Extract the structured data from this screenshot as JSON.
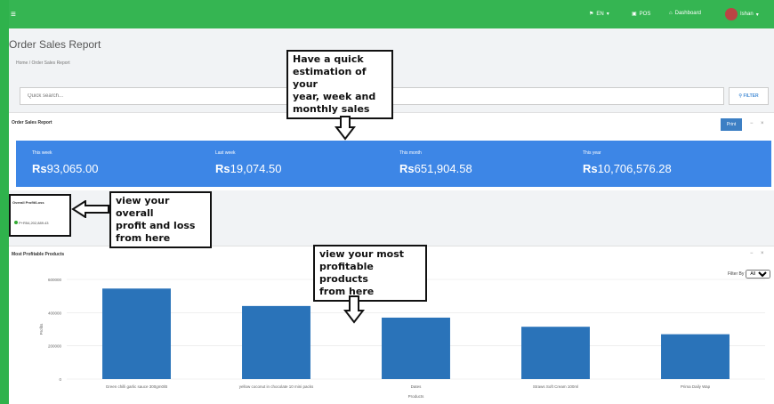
{
  "topbar": {
    "menu_icon": "hamburger-icon",
    "lang": "EN",
    "pos": "POS",
    "dashboard": "Dashboard",
    "user": "Ishan",
    "bg_color": "#35b552"
  },
  "page": {
    "title": "Order Sales Report",
    "breadcrumb": "Home / Order Sales Report"
  },
  "search": {
    "placeholder": "Quick search...",
    "filter_label": "FILTER"
  },
  "sales_panel": {
    "title": "Order Sales Report",
    "print_label": "Print",
    "collapse": "−",
    "close": "×",
    "stats": [
      {
        "label": "This week",
        "currency": "Rs",
        "amount": "93,065.00"
      },
      {
        "label": "Last week",
        "currency": "Rs",
        "amount": "19,074.50"
      },
      {
        "label": "This month",
        "currency": "Rs",
        "amount": "651,904.58"
      },
      {
        "label": "This year",
        "currency": "Rs",
        "amount": "10,706,576.28"
      }
    ],
    "stats_bg": "#3d86e6"
  },
  "profit_panel": {
    "title": "Overall Profit/Loss",
    "value": "P+R54,202,889.43"
  },
  "products_panel": {
    "title": "Most Profitable Products",
    "filter_label": "Filter By",
    "filter_value": "All",
    "collapse": "−",
    "close": "×"
  },
  "callouts": {
    "quick": [
      "Have a quick",
      "estimation of your",
      "year, week and",
      "monthly sales"
    ],
    "profit": [
      "view your overall",
      "profit and loss",
      "from here"
    ],
    "products": [
      "view your most",
      "profitable products",
      "from here"
    ]
  },
  "chart_data": {
    "type": "bar",
    "categories": [
      "Green chilli garlic sauce 300gm0/B",
      "yellow coconut in chocolate 10 mini packs",
      "Dates",
      "Straws Soft Cream 100ml",
      "Prima Daily Wap"
    ],
    "values": [
      545000,
      440000,
      370000,
      315000,
      270000
    ],
    "ylim": [
      0,
      600000
    ],
    "yticks": [
      0,
      200000,
      400000,
      600000
    ],
    "ytick_labels": [
      "0",
      "200000",
      "400000",
      "600000"
    ],
    "xlabel": "Products",
    "ylabel": "Profits",
    "bar_color": "#2a73b9",
    "grid": true
  }
}
